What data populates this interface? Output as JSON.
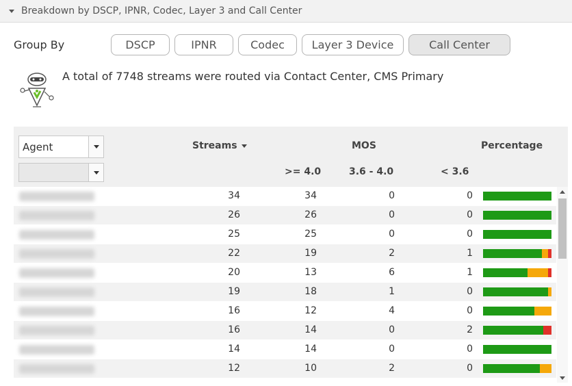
{
  "panel": {
    "title": "Breakdown by DSCP, IPNR, Codec, Layer 3 and Call Center",
    "collapse_icon": "caret-down-icon"
  },
  "group_by": {
    "label": "Group By",
    "buttons": [
      {
        "label": "DSCP",
        "active": false
      },
      {
        "label": "IPNR",
        "active": false
      },
      {
        "label": "Codec",
        "active": false
      },
      {
        "label": "Layer 3 Device",
        "active": false
      },
      {
        "label": "Call Center",
        "active": true
      }
    ]
  },
  "summary": {
    "icon": "robot-assistant-icon",
    "text": "A total of 7748 streams were routed via Contact Center, CMS Primary"
  },
  "table": {
    "agent_select": "Agent",
    "secondary_select": "",
    "headers": {
      "streams": "Streams",
      "mos": "MOS",
      "percentage": "Percentage",
      "mos_high": ">= 4.0",
      "mos_mid": "3.6 - 4.0",
      "mos_low": "< 3.6"
    },
    "rows": [
      {
        "streams": "34",
        "high": "34",
        "mid": "0",
        "low": "0"
      },
      {
        "streams": "26",
        "high": "26",
        "mid": "0",
        "low": "0"
      },
      {
        "streams": "25",
        "high": "25",
        "mid": "0",
        "low": "0"
      },
      {
        "streams": "22",
        "high": "19",
        "mid": "2",
        "low": "1"
      },
      {
        "streams": "20",
        "high": "13",
        "mid": "6",
        "low": "1"
      },
      {
        "streams": "19",
        "high": "18",
        "mid": "1",
        "low": "0"
      },
      {
        "streams": "16",
        "high": "12",
        "mid": "4",
        "low": "0"
      },
      {
        "streams": "16",
        "high": "14",
        "mid": "0",
        "low": "2"
      },
      {
        "streams": "14",
        "high": "14",
        "mid": "0",
        "low": "0"
      },
      {
        "streams": "12",
        "high": "10",
        "mid": "2",
        "low": "0"
      }
    ]
  },
  "colors": {
    "good": "#1e9a16",
    "fair": "#f5a80a",
    "poor": "#e0312a"
  }
}
